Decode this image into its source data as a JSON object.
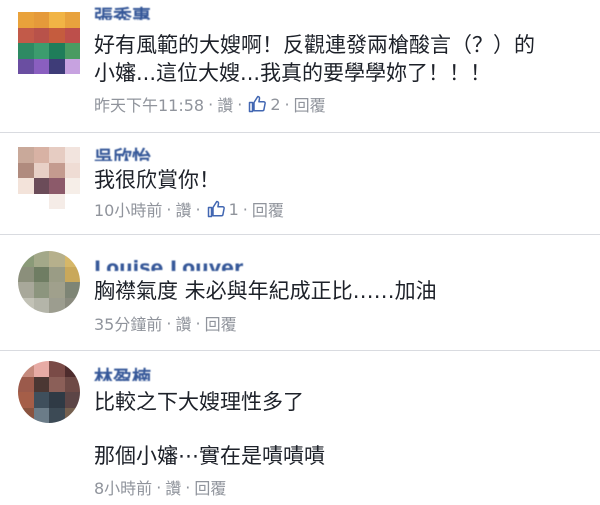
{
  "comments": [
    {
      "name": "張秀惠",
      "lines": [
        "好有風範的大嫂啊！反觀連發兩槍酸言（？）的",
        "小嬸...這位大嫂...我真的要學學妳了！！！"
      ],
      "time": "昨天下午11:58",
      "read": "讚",
      "likes": "2",
      "reply": "回覆"
    },
    {
      "name": "吳欣怡",
      "lines": [
        "我很欣賞你！"
      ],
      "time": "10小時前",
      "read": "讚",
      "likes": "1",
      "reply": "回覆"
    },
    {
      "name": "Louise Louver",
      "lines": [
        "胸襟氣度 未必與年紀成正比……加油"
      ],
      "time": "35分鐘前",
      "read": "讚",
      "reply": "回覆"
    },
    {
      "name": "林盈楠",
      "lines": [
        "比較之下大嫂理性多了",
        "",
        "那個小嬸⋯實在是嘖嘖嘖"
      ],
      "time": "8小時前",
      "read": "讚",
      "reply": "回覆"
    }
  ],
  "separator": "·",
  "like_icon": "thumbs-up-icon",
  "colors": {
    "meta": "#90949c",
    "text": "#1d2129",
    "name": "#365899",
    "like": "#4267b2",
    "divider": "#d9dbe0"
  }
}
